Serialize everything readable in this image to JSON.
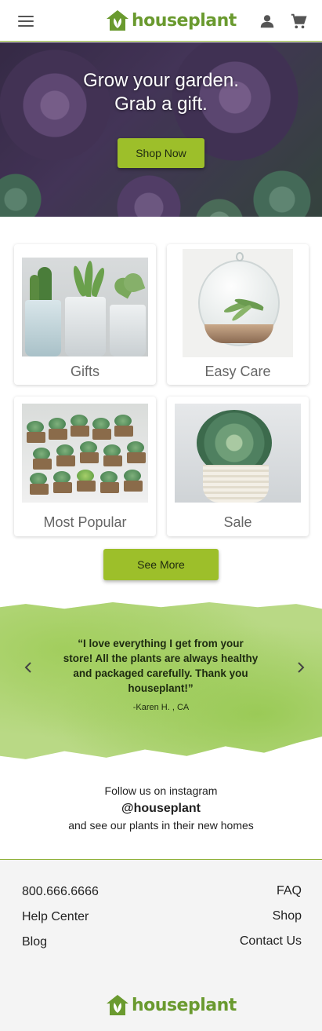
{
  "header": {
    "brand": "houseplant",
    "icons": [
      "menu-icon",
      "user-icon",
      "cart-icon"
    ]
  },
  "hero": {
    "title_line1": "Grow your garden.",
    "title_line2": "Grab a gift.",
    "button_label": "Shop Now"
  },
  "categories": [
    {
      "label": "Gifts"
    },
    {
      "label": "Easy Care"
    },
    {
      "label": "Most Popular"
    },
    {
      "label": "Sale"
    }
  ],
  "see_more_label": "See More",
  "testimonial": {
    "quote": "“I love everything I get from your store! All the plants are always healthy and packaged carefully. Thank you houseplant!”",
    "author": "-Karen H. , CA"
  },
  "instagram": {
    "line1": "Follow us on instagram",
    "handle": "@houseplant",
    "line3": "and see our plants in their new homes"
  },
  "footer": {
    "left_links": [
      "800.666.6666",
      "Help Center",
      "Blog"
    ],
    "right_links": [
      "FAQ",
      "Shop",
      "Contact Us"
    ],
    "brand": "houseplant"
  },
  "colors": {
    "accent": "#9dbf2a",
    "brand": "#6a9a2f"
  }
}
